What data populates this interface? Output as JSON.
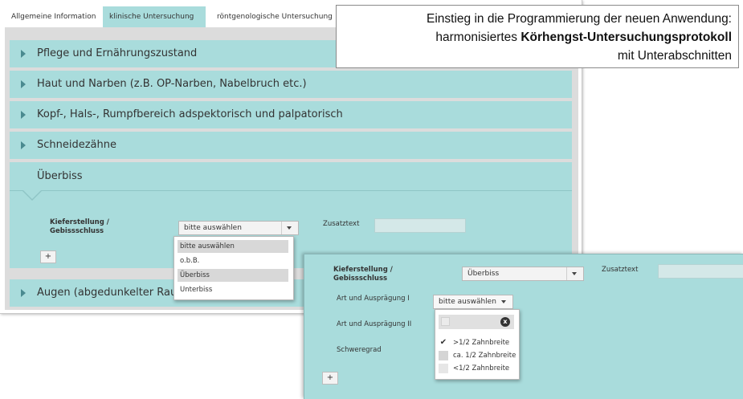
{
  "tabs": [
    "Allgemeine Information",
    "klinische Untersuchung",
    "röntgenologische Untersuchung"
  ],
  "sections": [
    "Pflege und Ernährungszustand",
    "Haut und Narben (z.B. OP-Narben, Nabelbruch etc.)",
    "Kopf-, Hals-, Rumpfbereich adspektorisch und palpatorisch",
    "Schneidezähne"
  ],
  "open_section": {
    "title": "Überbiss",
    "field_label_line1": "Kieferstellung /",
    "field_label_line2": "Gebissschluss",
    "select_value": "bitte auswählen",
    "zusatz_label": "Zusatztext",
    "add_label": "+"
  },
  "dropdown_options": [
    "bitte auswählen",
    "o.b.B.",
    "Überbiss",
    "Unterbiss"
  ],
  "last_section_partial": "Augen (abgedunkelter Rau",
  "callout": {
    "line1": "Einstieg in die Programmierung der neuen Anwendung:",
    "line2_prefix": "harmonisiertes ",
    "line2_bold": "Körhengst-Untersuchungsprotokoll",
    "line3": "mit Unterabschnitten"
  },
  "panel2": {
    "field_label_line1": "Kieferstellung /",
    "field_label_line2": "Gebissschluss",
    "select_value": "Überbiss",
    "zusatz_label": "Zusatztext",
    "art1_label": "Art und Ausprägung I",
    "art1_select": "bitte auswählen",
    "art2_label": "Art und Ausprägung II",
    "schweregrad_label": "Schweregrad",
    "add_label": "+",
    "dd_options": [
      ">1/2 Zahnbreite",
      "ca. 1/2 Zahnbreite",
      "<1/2 Zahnbreite"
    ],
    "dd_clear": "x"
  },
  "colors": {
    "teal": "#a9dcdc",
    "tab_active": "#a9dcdc",
    "grey_bg": "#dcdcdc"
  }
}
